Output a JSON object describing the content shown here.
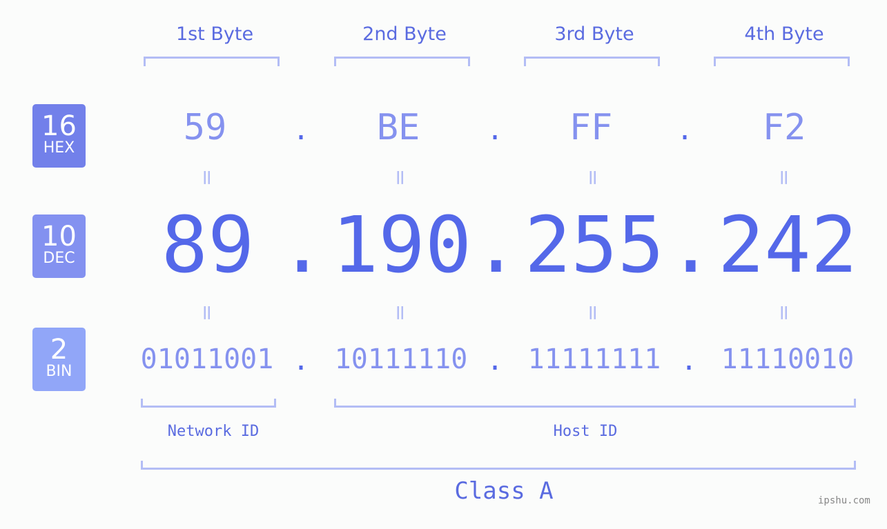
{
  "columns": [
    "1st Byte",
    "2nd Byte",
    "3rd Byte",
    "4th Byte"
  ],
  "badges": {
    "hex": {
      "base": "16",
      "label": "HEX",
      "color": "#7280ea"
    },
    "dec": {
      "base": "10",
      "label": "DEC",
      "color": "#8391f0"
    },
    "bin": {
      "base": "2",
      "label": "BIN",
      "color": "#91a6f8"
    }
  },
  "hex": [
    "59",
    "BE",
    "FF",
    "F2"
  ],
  "dec": [
    "89",
    "190",
    "255",
    "242"
  ],
  "bin": [
    "01011001",
    "10111110",
    "11111111",
    "11110010"
  ],
  "separator": ".",
  "equals": "=",
  "network_id_label": "Network ID",
  "host_id_label": "Host ID",
  "class_label": "Class A",
  "watermark": "ipshu.com"
}
